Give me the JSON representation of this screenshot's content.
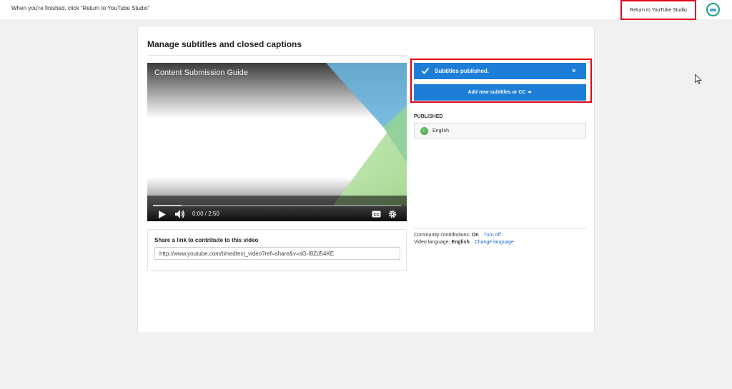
{
  "topbar": {
    "message": "When you're finished, click “Return to YouTube Studio”",
    "return_button": "Return to YouTube Studio",
    "avatar_icon": "channel-avatar-icon"
  },
  "page": {
    "title": "Manage subtitles and closed captions"
  },
  "player": {
    "video_title": "Content Submission Guide",
    "time": "0:00 / 2:50",
    "play_icon": "play-icon",
    "volume_icon": "volume-icon",
    "cc_icon": "cc-icon",
    "settings_icon": "gear-icon",
    "progress_fraction": 0
  },
  "share": {
    "title": "Share a link to contribute to this video",
    "url": "http://www.youtube.com/timedtext_video?ref=share&v=sG-I8Zd54KE"
  },
  "notification": {
    "text": "Subtitles published.",
    "close": "×"
  },
  "add_button": {
    "label": "Add new subtitles or CC"
  },
  "published": {
    "label": "PUBLISHED",
    "languages": [
      {
        "name": "English"
      }
    ]
  },
  "info": {
    "community_label": "Community contributions:",
    "community_value": "On",
    "community_link": "Turn off",
    "language_label": "Video language:",
    "language_value": "English",
    "language_link": "Change language"
  },
  "colors": {
    "accent_blue": "#1c7ed6",
    "highlight_red": "#e0001a",
    "link_blue": "#1a6dcc"
  }
}
